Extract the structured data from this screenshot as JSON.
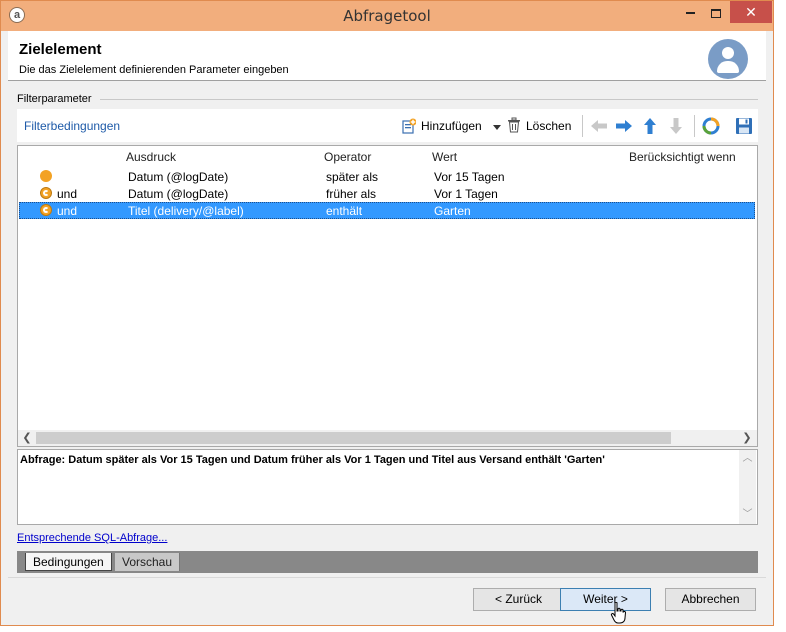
{
  "window": {
    "title": "Abfragetool"
  },
  "header": {
    "title": "Zielelement",
    "subtitle": "Die das Zielelement definierenden Parameter eingeben"
  },
  "filter": {
    "group_label": "Filterparameter",
    "link_label": "Filterbedingungen",
    "add_label": "Hinzufügen",
    "delete_label": "Löschen"
  },
  "grid": {
    "columns": [
      "Ausdruck",
      "Operator",
      "Wert",
      "Berücksichtigt wenn"
    ],
    "rows": [
      {
        "connector": "",
        "expression": "Datum (@logDate)",
        "operator": "später als",
        "value": "Vor 15 Tagen",
        "condition": ""
      },
      {
        "connector": "und",
        "expression": "Datum (@logDate)",
        "operator": "früher als",
        "value": "Vor 1 Tagen",
        "condition": ""
      },
      {
        "connector": "und",
        "expression": "Titel (delivery/@label)",
        "operator": "enthält",
        "value": "Garten",
        "condition": ""
      }
    ]
  },
  "summary": {
    "text": "Abfrage: Datum später als Vor 15 Tagen und Datum früher als Vor 1 Tagen und Titel aus Versand enthält 'Garten'"
  },
  "sql_link": "Entsprechende SQL-Abfrage...",
  "tabs": [
    "Bedingungen",
    "Vorschau"
  ],
  "buttons": {
    "back": "< Zurück",
    "next": "Weiter >",
    "cancel": "Abbrechen"
  },
  "colors": {
    "titlebar": "#f2ae7d",
    "close": "#c7504a",
    "selection": "#3399ff",
    "link": "#1e5aa8",
    "avatar": "#7a9cc6"
  }
}
